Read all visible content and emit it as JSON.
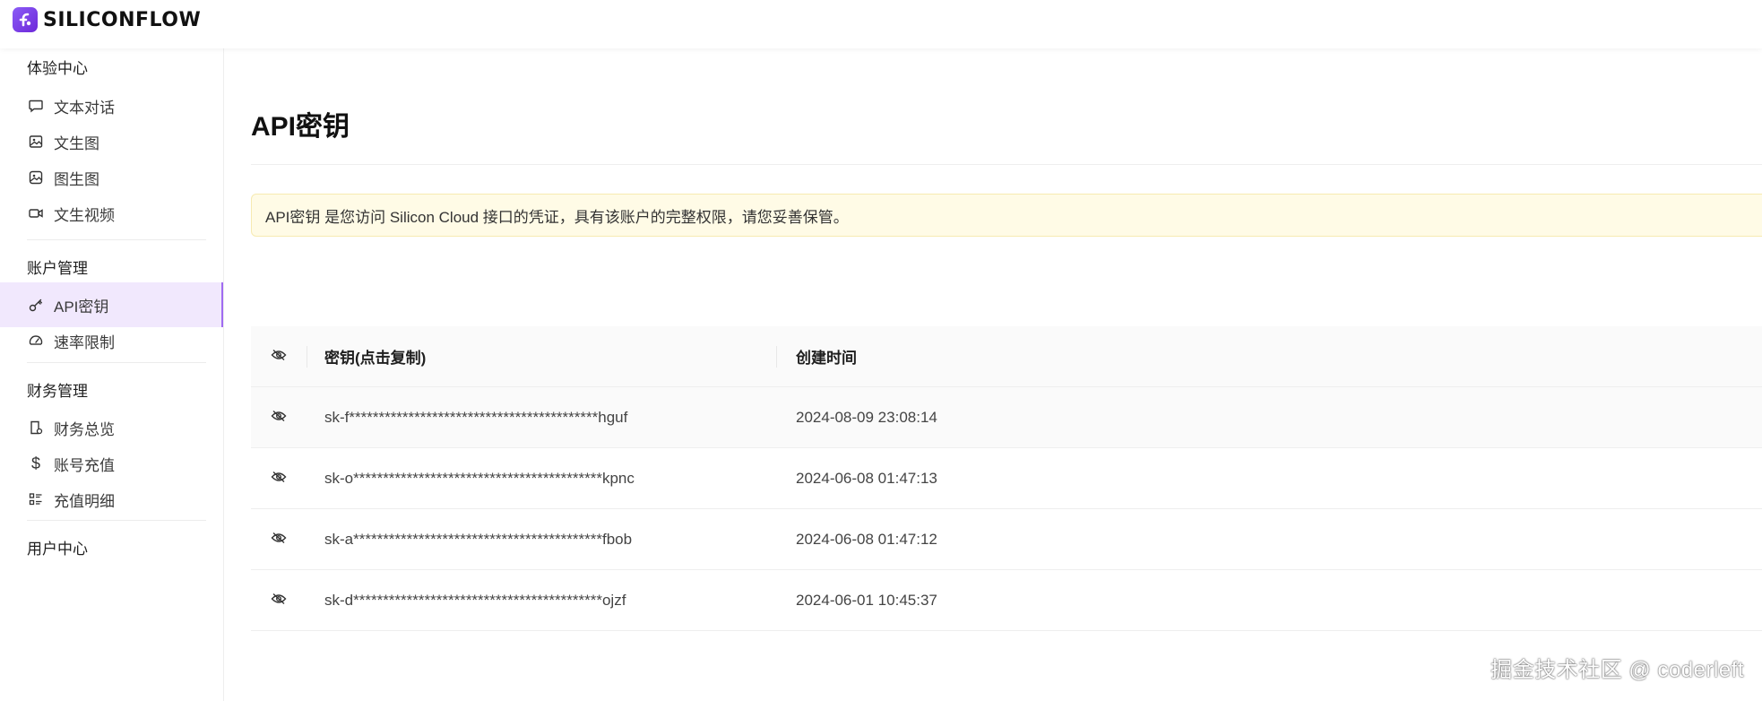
{
  "brand": {
    "name": "SILICONFLOW",
    "accent": "#8b5cf6"
  },
  "sidebar": {
    "groups": [
      {
        "title": "体验中心",
        "items": [
          {
            "label": "文本对话",
            "icon": "chat-bubble-icon"
          },
          {
            "label": "文生图",
            "icon": "image-icon"
          },
          {
            "label": "图生图",
            "icon": "image-to-image-icon"
          },
          {
            "label": "文生视频",
            "icon": "video-camera-icon"
          }
        ]
      },
      {
        "title": "账户管理",
        "items": [
          {
            "label": "API密钥",
            "icon": "key-icon",
            "active": true
          },
          {
            "label": "速率限制",
            "icon": "speedometer-icon"
          }
        ]
      },
      {
        "title": "财务管理",
        "items": [
          {
            "label": "财务总览",
            "icon": "bill-icon"
          },
          {
            "label": "账号充值",
            "icon": "dollar-icon"
          },
          {
            "label": "充值明细",
            "icon": "list-detail-icon"
          }
        ]
      },
      {
        "title": "用户中心",
        "items": []
      }
    ]
  },
  "main": {
    "title": "API密钥",
    "notice": "API密钥 是您访问 Silicon Cloud 接口的凭证，具有该账户的完整权限，请您妥善保管。",
    "table": {
      "headers": {
        "key": "密钥(点击复制)",
        "created": "创建时间"
      },
      "rows": [
        {
          "key": "sk-f******************************************hguf",
          "created": "2024-08-09 23:08:14"
        },
        {
          "key": "sk-o******************************************kpnc",
          "created": "2024-06-08 01:47:13"
        },
        {
          "key": "sk-a******************************************fbob",
          "created": "2024-06-08 01:47:12"
        },
        {
          "key": "sk-d******************************************ojzf",
          "created": "2024-06-01 10:45:37"
        }
      ]
    }
  },
  "watermark": "掘金技术社区 @ coderleft"
}
